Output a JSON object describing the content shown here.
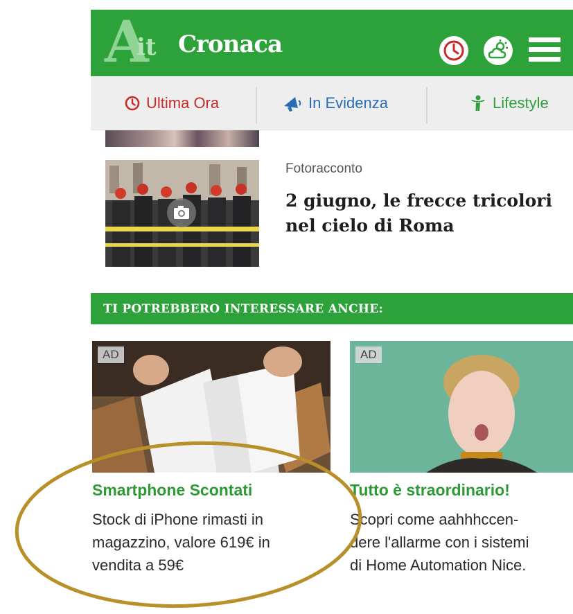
{
  "header": {
    "logo_letter": "A",
    "logo_it": "it",
    "section_name": "Cronaca",
    "brand_green": "#2ea23a",
    "icons": [
      "clock-icon",
      "weather-icon",
      "menu-icon"
    ]
  },
  "nav": {
    "tabs": [
      {
        "label": "Ultima Ora",
        "icon": "clock-icon",
        "color": "#c62a2a"
      },
      {
        "label": "In Evidenza",
        "icon": "megaphone-icon",
        "color": "#2b6db5"
      },
      {
        "label": "Lifestyle",
        "icon": "person-icon",
        "color": "#2f9f3b"
      }
    ]
  },
  "article": {
    "kicker": "Fotoracconto",
    "headline": "2 giugno, le frecce tricolori nel cielo di Roma",
    "media_icon": "camera-icon"
  },
  "section": {
    "title": "TI POTREBBERO INTERESSARE ANCHE:"
  },
  "ads": [
    {
      "badge": "AD",
      "title": "Smartphone Scontati",
      "body_lines": [
        "Stock di iPhone rimasti in",
        "magazzino, valore 619€ in",
        "vendita a 59€"
      ]
    },
    {
      "badge": "AD",
      "title": "Tutto è straordinario!",
      "body_lines": [
        "Scopri come aahhhccen-",
        "dere l'allarme con i sistemi",
        "di Home Automation Nice."
      ]
    }
  ],
  "annotation": {
    "shape": "ellipse",
    "color": "#b8902a"
  }
}
